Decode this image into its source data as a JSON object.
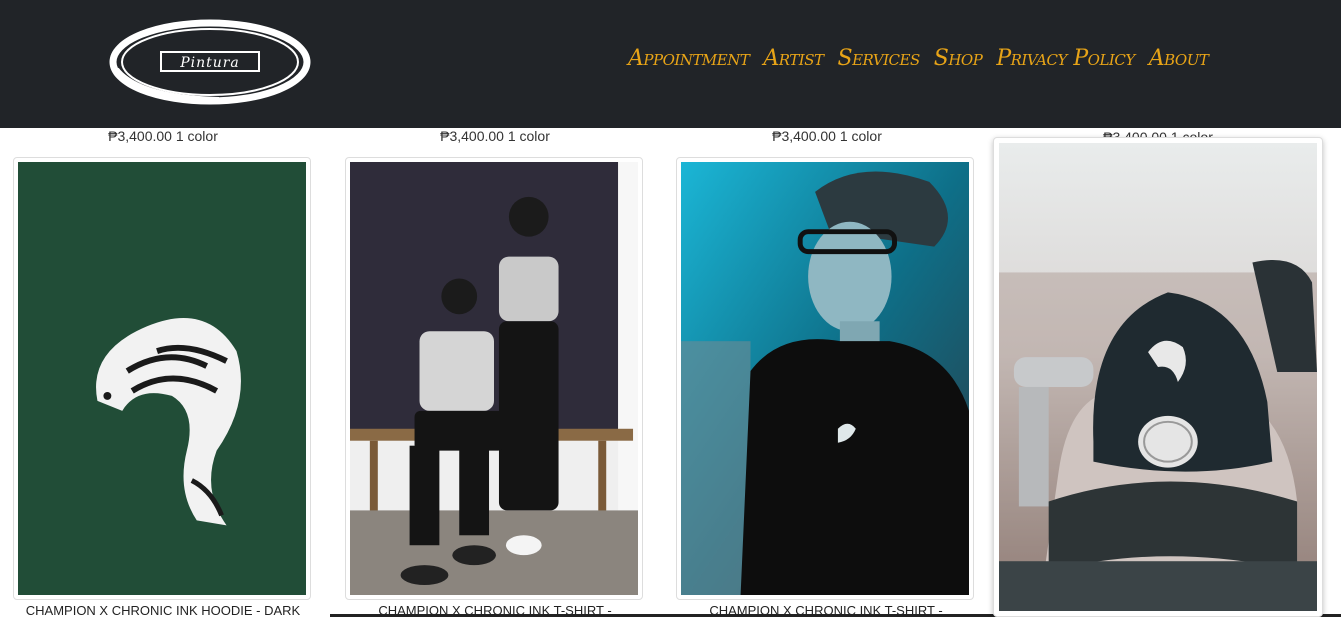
{
  "header": {
    "logo_text": "Pintura",
    "nav": [
      "Appointment",
      "Artist",
      "Services",
      "Shop",
      "Privacy Policy",
      "About"
    ]
  },
  "products": [
    {
      "price": "₱3,400.00 1 color",
      "title": "CHAMPION X CHRONIC INK HOODIE - DARK",
      "image": "green-hoodie-koi-closeup"
    },
    {
      "price": "₱3,400.00 1 color",
      "title": "CHAMPION X CHRONIC INK T-SHIRT -",
      "image": "couple-grey-shirts"
    },
    {
      "price": "₱3,400.00 1 color",
      "title": "CHAMPION X CHRONIC INK T-SHIRT -",
      "image": "black-shirt-model"
    },
    {
      "price": "₱3,400.00 1 color",
      "title": "",
      "image": "black-cap-koi"
    }
  ],
  "colors": {
    "header_bg": "#212428",
    "nav_text": "#e8a417"
  }
}
